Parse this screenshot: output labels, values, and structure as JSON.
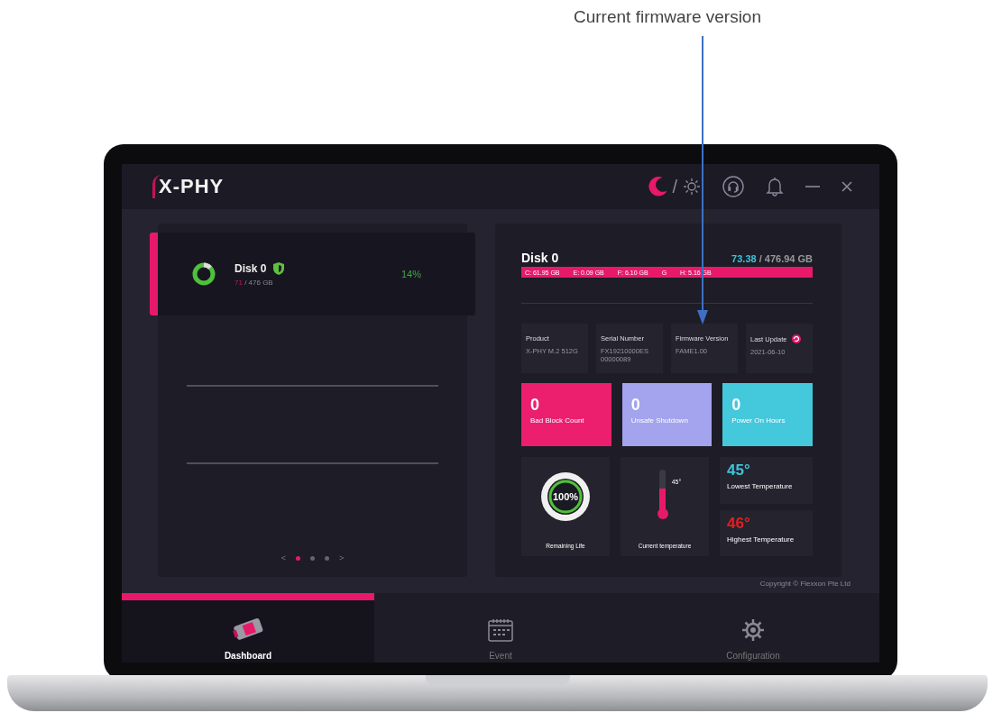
{
  "annotation": {
    "text": "Current firmware version"
  },
  "header": {
    "logo": "X-PHY",
    "theme_toggle": {
      "separator": "/",
      "options": [
        {
          "kind": "moon",
          "selected": true
        },
        {
          "kind": "sun",
          "selected": false
        }
      ]
    }
  },
  "disk_list": {
    "items": [
      {
        "name": "Disk 0",
        "used": "71",
        "total": " / 476 GB",
        "percent": "14%",
        "selected": true
      }
    ],
    "pages": [
      {
        "selected": true
      },
      {
        "selected": false
      },
      {
        "selected": false
      }
    ],
    "prev": "<",
    "next": ">"
  },
  "disk_detail": {
    "title": "Disk 0",
    "used": "73.38",
    "total": " / 476.94 GB",
    "partitions": [
      "C: 61.95 GB",
      "E: 0.09 GB",
      "F: 6.10 GB",
      "G",
      "H: 5.16 GB"
    ],
    "info": [
      {
        "label": "Product",
        "value": "X-PHY M.2 512G",
        "refresh": false
      },
      {
        "label": "Serial Number",
        "value": "FX19210000ES 00000089",
        "refresh": false
      },
      {
        "label": "Firmware Version",
        "value": "FAME1.00",
        "refresh": false
      },
      {
        "label": "Last Update",
        "value": "2021-06-10",
        "refresh": true
      }
    ],
    "stats": [
      {
        "value": "0",
        "label": "Bad Block Count",
        "color": "#ec1e6e"
      },
      {
        "value": "0",
        "label": "Unsafe Shutdown",
        "color": "#a3a3ee"
      },
      {
        "value": "0",
        "label": "Power On Hours",
        "color": "#44c8dc"
      }
    ],
    "remaining_life": {
      "reading": "100%",
      "label": "Remaining Life",
      "level": 1
    },
    "current_temperature": {
      "reading": "45°",
      "label": "Current temperature",
      "level": 0.55
    },
    "temperatures": [
      {
        "value": "45°",
        "label": "Lowest Temperature",
        "color": "#3ec3d8"
      },
      {
        "value": "46°",
        "label": "Highest Temperature",
        "color": "#e81e1e"
      }
    ]
  },
  "copyright": "Copyright © Flexxon Pte Ltd",
  "nav": [
    {
      "kind": "drive",
      "label": "Dashboard",
      "selected": true
    },
    {
      "kind": "calendar",
      "label": "Event",
      "selected": false
    },
    {
      "kind": "gear",
      "label": "Configuration",
      "selected": false
    }
  ]
}
